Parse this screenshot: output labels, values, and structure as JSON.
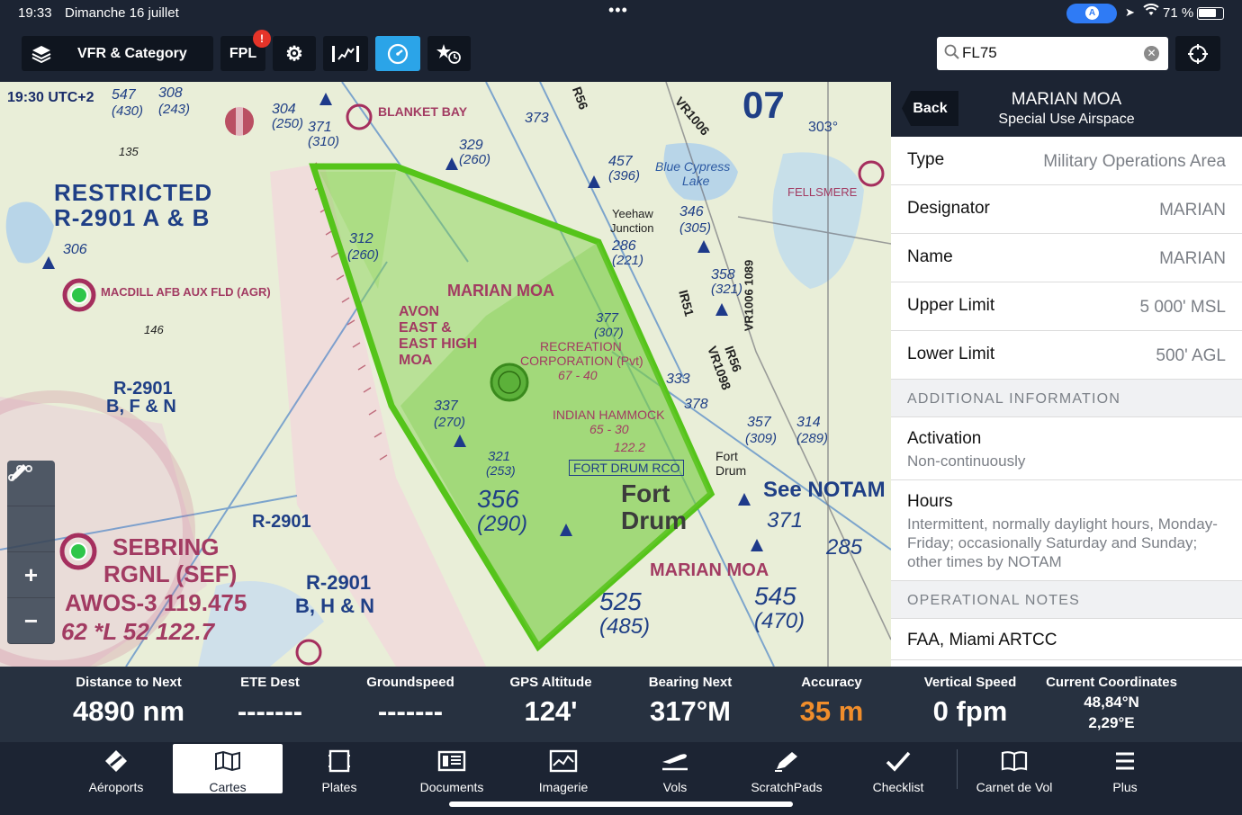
{
  "status_bar": {
    "time": "19:33",
    "date": "Dimanche 16 juillet",
    "dots": "•••",
    "battery": "71 %"
  },
  "toolbar": {
    "layers_label": "VFR & Category",
    "fpl_label": "FPL",
    "fpl_badge": "!",
    "search_value": "FL75"
  },
  "map": {
    "utc_label": "19:30 UTC+2",
    "labels": {
      "restricted": "RESTRICTED",
      "r2901ab": "R-2901 A & B",
      "marian_moa": "MARIAN MOA",
      "marian_moa_2": "MARIAN MOA",
      "avon": "AVON",
      "east": "EAST &",
      "east_high": "EAST HIGH",
      "moa": "MOA",
      "recreation": "RECREATION",
      "corporation": "CORPORATION (Pvt)",
      "indian_hammock": "INDIAN HAMMOCK",
      "fort_drum_rco": "FORT DRUM RCO",
      "fort_drum": "Fort",
      "fort_drum_2": "Drum",
      "fort_town": "Fort",
      "drum_town": "Drum",
      "sebring": "SEBRING",
      "sebring_rgnl": "RGNL (SEF)",
      "awos": "AWOS-3 119.475",
      "awos2": "62 *L 52 122.7",
      "macdill": "MACDILL AFB AUX FLD (AGR)",
      "blanket_bay": "BLANKET BAY",
      "blue_cypress": "Blue Cypress",
      "blue_cypress_2": "Lake",
      "yeehaw": "Yeehaw",
      "yeehaw_2": "Junction",
      "fellsmere": "FELLSMERE",
      "see_notam": "See NOTAM",
      "r2901bfn": "R-2901",
      "r2901bfn2": "B, F & N",
      "r2901bgn": "R-2901",
      "r2901hn": "R-2901",
      "r2901hn2": "B, H & N",
      "n07": "07",
      "n303": "303°",
      "n356": "356",
      "n290": "(290)",
      "n525": "525",
      "n485": "(485)",
      "n545": "545",
      "n470": "(470)",
      "n371": "371",
      "n285": "285",
      "n377": "377",
      "n307": "(307)",
      "n337": "337",
      "n270": "(270)",
      "n312": "312",
      "n260": "(260)",
      "n357": "357",
      "n309": "(309)",
      "n314": "314",
      "n289": "(289)",
      "n457": "457",
      "n396": "(396)",
      "n547": "547",
      "n430": "(430)",
      "n308": "308",
      "n243": "(243)",
      "n304": "304",
      "n250": "(250)",
      "n371b": "371",
      "n310": "(310)",
      "n329": "329",
      "n260b": "(260)",
      "n373": "373",
      "n346": "346",
      "n305": "(305)",
      "n286": "286",
      "n221": "(221)",
      "n358": "358",
      "n321": "(321)",
      "n333": "333",
      "n378": "378",
      "n306": "306",
      "n146": "146",
      "n135": "135",
      "n122_2": "122.2",
      "n65_30": "65 - 30",
      "n67_40": "67 - 40",
      "ir51": "IR51",
      "vr1006": "VR1006",
      "vr1098": "VR1098",
      "vr1006_1089": "VR1006 1089",
      "r56": "R56",
      "ir56": "IR56",
      "n321b": "321",
      "n253": "(253)"
    }
  },
  "panel": {
    "back_label": "Back",
    "title": "MARIAN MOA",
    "subtitle": "Special Use Airspace",
    "rows": [
      {
        "key": "Type",
        "value": "Military Operations Area"
      },
      {
        "key": "Designator",
        "value": "MARIAN"
      },
      {
        "key": "Name",
        "value": "MARIAN"
      },
      {
        "key": "Upper Limit",
        "value": "5 000' MSL"
      },
      {
        "key": "Lower Limit",
        "value": "500' AGL"
      }
    ],
    "section_additional": "ADDITIONAL INFORMATION",
    "activation": {
      "key": "Activation",
      "value": "Non-continuously"
    },
    "hours": {
      "key": "Hours",
      "value": "Intermittent, normally daylight hours, Monday-Friday; occasionally Saturday and Sunday; other times by NOTAM"
    },
    "section_operational": "OPERATIONAL NOTES",
    "operational": {
      "key": "FAA, Miami ARTCC"
    }
  },
  "instruments": [
    {
      "key": "Distance to Next",
      "value": "4890 nm"
    },
    {
      "key": "ETE Dest",
      "value": "-------"
    },
    {
      "key": "Groundspeed",
      "value": "-------"
    },
    {
      "key": "GPS Altitude",
      "value": "124'"
    },
    {
      "key": "Bearing Next",
      "value": "317°M"
    },
    {
      "key": "Accuracy",
      "value": "35 m"
    },
    {
      "key": "Vertical Speed",
      "value": "0 fpm"
    },
    {
      "key": "Current Coordinates",
      "value": "48,84°N",
      "value2": "2,29°E"
    }
  ],
  "bottom_nav": [
    {
      "label": "Aéroports",
      "icon": "airport-icon"
    },
    {
      "label": "Cartes",
      "icon": "map-icon"
    },
    {
      "label": "Plates",
      "icon": "plates-icon"
    },
    {
      "label": "Documents",
      "icon": "documents-icon"
    },
    {
      "label": "Imagerie",
      "icon": "imagery-icon"
    },
    {
      "label": "Vols",
      "icon": "flights-icon"
    },
    {
      "label": "ScratchPads",
      "icon": "scratchpad-icon"
    },
    {
      "label": "Checklist",
      "icon": "checklist-icon"
    },
    {
      "label": "Carnet de Vol",
      "icon": "logbook-icon"
    },
    {
      "label": "Plus",
      "icon": "more-icon"
    }
  ],
  "colors": {
    "accent": "#2ba4e8",
    "toolbar_bg": "#1c2433",
    "moa_fill": "#7ed04a",
    "moa_stroke": "#55c41a",
    "accuracy": "#f08d2b",
    "badge": "#e53429"
  }
}
